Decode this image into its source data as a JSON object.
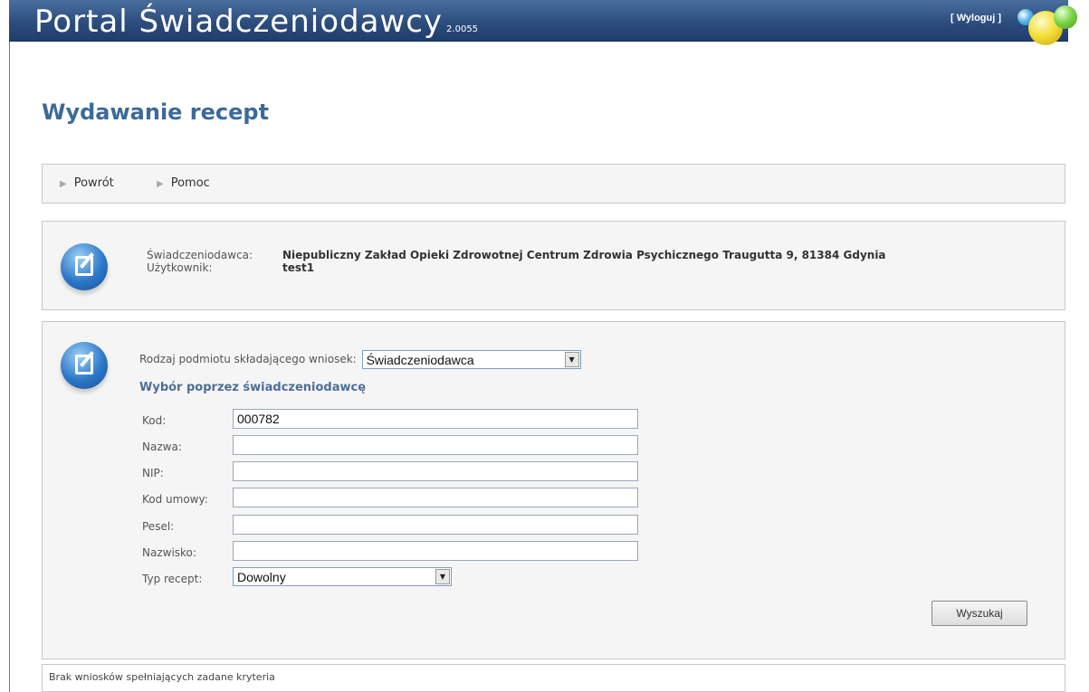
{
  "header": {
    "title": "Portal Świadczeniodawcy",
    "version": "2.0055",
    "logout_label": "[ Wyloguj ]"
  },
  "page": {
    "title": "Wydawanie recept"
  },
  "nav": {
    "back_label": "Powrót",
    "help_label": "Pomoc"
  },
  "info": {
    "provider_label": "Świadczeniodawca:",
    "provider_value": "Niepubliczny Zakład Opieki Zdrowotnej Centrum Zdrowia Psychicznego Traugutta 9, 81384 Gdynia",
    "user_label": "Użytkownik:",
    "user_value": "test1"
  },
  "form": {
    "entity_type_label": "Rodzaj podmiotu składającego wniosek:",
    "entity_type_value": "Świadczeniodawca",
    "section_title": "Wybór poprzez świadczeniodawcę",
    "fields": [
      {
        "label": "Kod:",
        "value": "000782"
      },
      {
        "label": "Nazwa:",
        "value": ""
      },
      {
        "label": "NIP:",
        "value": ""
      },
      {
        "label": "Kod umowy:",
        "value": ""
      },
      {
        "label": "Pesel:",
        "value": ""
      },
      {
        "label": "Nazwisko:",
        "value": ""
      }
    ],
    "prescription_type_label": "Typ recept:",
    "prescription_type_value": "Dowolny",
    "search_label": "Wyszukaj"
  },
  "status": {
    "message": "Brak wniosków spełniających zadane kryteria"
  },
  "colors": {
    "header_blue": "#2c4d7e",
    "title_blue": "#3c6a9a",
    "section_blue": "#4d6f97",
    "panel_bg": "#f5f5f5"
  },
  "icons": {
    "logout": "orbs-logo",
    "info_panel": "edit-document-icon",
    "form_panel": "edit-document-icon",
    "nav_arrow": "triangle-right-icon",
    "dropdown": "chevron-down-icon"
  }
}
